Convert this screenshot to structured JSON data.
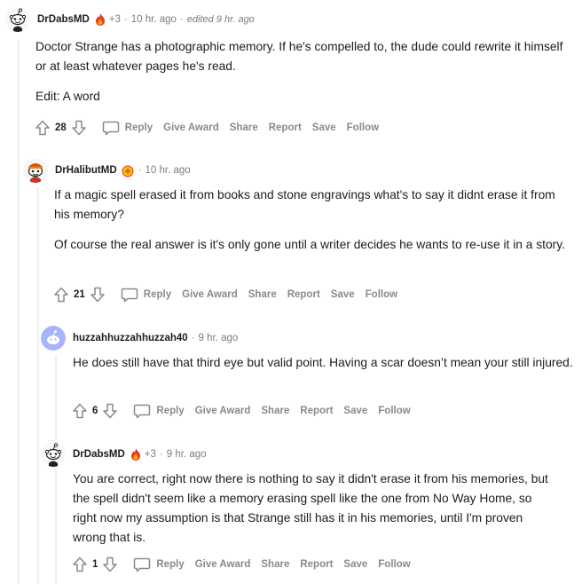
{
  "comments": [
    {
      "username": "DrDabsMD",
      "karma": "+3",
      "time": "10 hr. ago",
      "edited": "edited 9 hr. ago",
      "paragraphs": [
        "Doctor Strange has a photographic memory. If he's compelled to, the dude could rewrite it himself or at least whatever pages he's read.",
        "Edit: A word"
      ],
      "score": "28"
    },
    {
      "username": "DrHalibutMD",
      "time": "10 hr. ago",
      "paragraphs": [
        "If a magic spell erased it from books and stone engravings what's to say it didnt erase it from his memory?",
        "Of course the real answer is it's only gone until a writer decides he wants to re-use it in a story."
      ],
      "score": "21"
    },
    {
      "username": "huzzahhuzzahhuzzah40",
      "time": "9 hr. ago",
      "paragraphs": [
        "He does still have that third eye but valid point. Having a scar doesn’t mean your still injured."
      ],
      "score": "6"
    },
    {
      "username": "DrDabsMD",
      "karma": "+3",
      "time": "9 hr. ago",
      "paragraphs": [
        "You are correct, right now there is nothing to say it didn't erase it from his memories, but the spell didn't seem like a memory erasing spell like the one from No Way Home, so right now my assumption is that Strange still has it in his memories, until I'm proven wrong that is."
      ],
      "score": "1"
    }
  ],
  "actions": {
    "reply": "Reply",
    "give_award": "Give Award",
    "share": "Share",
    "report": "Report",
    "save": "Save",
    "follow": "Follow"
  },
  "separator": "·",
  "colors": {
    "action_gray": "#878a8c",
    "meta_gray": "#7c7c7c",
    "thread_line": "#edeff1",
    "huzzah_avatar": "#a5b4fc",
    "flair_red": "#e8382b"
  },
  "icons": {
    "upvote": "arrow-up-outline-icon",
    "downvote": "arrow-down-outline-icon",
    "reply": "speech-bubble-icon",
    "flair": "flame-flair-icon",
    "avatar": "snoo-avatar-icon"
  }
}
